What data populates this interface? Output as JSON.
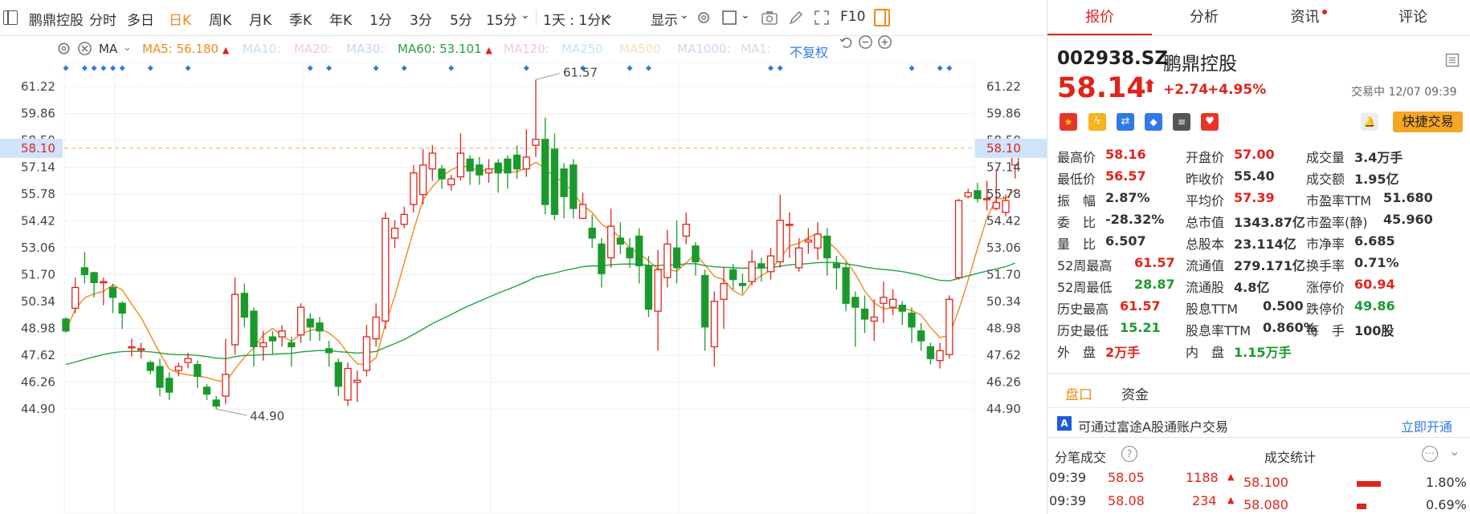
{
  "toolbar": {
    "stock_name": "鹏鼎控股",
    "periods": [
      "分时",
      "多日",
      "日K",
      "周K",
      "月K",
      "季K",
      "年K",
      "1分",
      "3分",
      "5分",
      "15分"
    ],
    "active_period": "日K",
    "range_label": "1天 : 1分K",
    "display_label": "显示",
    "f10_label": "F10"
  },
  "ma_bar": {
    "ma_label": "MA",
    "items": [
      {
        "label": "MA5:",
        "value": "56.180",
        "color": "#f08a1c"
      },
      {
        "label": "MA10:",
        "value": "",
        "color": "#c7dff5"
      },
      {
        "label": "MA20:",
        "value": "",
        "color": "#f5c6d8"
      },
      {
        "label": "MA30:",
        "value": "",
        "color": "#c2d7f0"
      },
      {
        "label": "MA60:",
        "value": "53.101",
        "color": "#27a040"
      },
      {
        "label": "MA120:",
        "value": "",
        "color": "#f5c6d0"
      },
      {
        "label": "MA250",
        "value": "",
        "color": "#bfe6f5"
      },
      {
        "label": "MA500",
        "value": "",
        "color": "#f5e2b5"
      },
      {
        "label": "MA1000:",
        "value": "",
        "color": "#d8d0f0"
      },
      {
        "label": "MA1:",
        "value": "",
        "color": "#d5dbe5"
      }
    ],
    "restore_label": "不复权"
  },
  "chart_data": {
    "type": "candlestick",
    "y_ticks": [
      "61.22",
      "59.86",
      "58.50",
      "57.14",
      "55.78",
      "54.42",
      "53.06",
      "51.70",
      "50.34",
      "48.98",
      "47.62",
      "46.26",
      "44.90"
    ],
    "ylim": [
      44.3,
      62.0
    ],
    "current_price_label": "58.10",
    "high_annotation": "61.57",
    "low_annotation": "44.90",
    "candles": [
      [
        49.45,
        48.85,
        49.55,
        48.75
      ],
      [
        50.0,
        51.05,
        51.55,
        49.75
      ],
      [
        52.05,
        51.7,
        52.85,
        51.25
      ],
      [
        51.8,
        51.3,
        51.85,
        50.55
      ],
      [
        51.3,
        51.35,
        51.55,
        50.15
      ],
      [
        51.05,
        50.55,
        51.25,
        49.75
      ],
      [
        50.25,
        49.75,
        50.35,
        48.95
      ],
      [
        48.05,
        48.05,
        48.45,
        47.55
      ],
      [
        47.95,
        47.95,
        48.25,
        47.45
      ],
      [
        47.25,
        46.85,
        47.35,
        46.65
      ],
      [
        47.05,
        46.0,
        47.45,
        45.55
      ],
      [
        46.45,
        45.75,
        46.75,
        45.35
      ],
      [
        46.85,
        47.05,
        47.25,
        46.55
      ],
      [
        47.25,
        47.45,
        47.75,
        46.95
      ],
      [
        47.15,
        46.55,
        47.35,
        45.95
      ],
      [
        46.0,
        45.65,
        46.15,
        45.35
      ],
      [
        45.35,
        45.05,
        45.55,
        44.9
      ],
      [
        45.55,
        46.65,
        48.45,
        45.15
      ],
      [
        48.15,
        50.7,
        51.55,
        47.65
      ],
      [
        50.75,
        49.55,
        51.25,
        49.05
      ],
      [
        49.85,
        48.05,
        50.05,
        47.05
      ],
      [
        48.05,
        48.25,
        48.85,
        47.35
      ],
      [
        48.55,
        48.35,
        48.85,
        47.65
      ],
      [
        48.55,
        48.85,
        49.15,
        48.05
      ],
      [
        48.25,
        48.05,
        48.55,
        47.05
      ],
      [
        48.65,
        50.05,
        50.25,
        48.25
      ],
      [
        49.45,
        49.05,
        49.75,
        48.35
      ],
      [
        49.25,
        48.85,
        49.55,
        48.35
      ],
      [
        47.95,
        47.75,
        48.35,
        47.05
      ],
      [
        47.25,
        46.05,
        47.45,
        45.55
      ],
      [
        45.35,
        46.95,
        47.25,
        45.05
      ],
      [
        46.25,
        46.35,
        46.85,
        45.25
      ],
      [
        46.85,
        48.55,
        49.15,
        46.55
      ],
      [
        48.45,
        49.55,
        50.25,
        48.05
      ],
      [
        49.35,
        54.55,
        54.85,
        48.95
      ],
      [
        53.55,
        54.05,
        54.45,
        53.05
      ],
      [
        54.25,
        54.75,
        55.15,
        54.05
      ],
      [
        55.25,
        56.85,
        57.25,
        54.85
      ],
      [
        55.75,
        57.25,
        58.05,
        55.25
      ],
      [
        57.05,
        57.85,
        58.25,
        56.45
      ],
      [
        57.05,
        56.55,
        57.25,
        56.05
      ],
      [
        56.25,
        56.55,
        56.75,
        55.95
      ],
      [
        56.65,
        57.85,
        58.85,
        56.45
      ],
      [
        57.55,
        56.95,
        57.75,
        56.25
      ],
      [
        57.25,
        56.75,
        57.65,
        56.25
      ],
      [
        56.85,
        57.05,
        57.55,
        56.35
      ],
      [
        57.35,
        56.85,
        57.55,
        55.85
      ],
      [
        57.55,
        56.85,
        57.75,
        56.05
      ],
      [
        57.75,
        57.05,
        58.25,
        56.55
      ],
      [
        57.05,
        57.65,
        59.05,
        56.65
      ],
      [
        58.25,
        58.55,
        61.57,
        57.65
      ],
      [
        58.55,
        55.25,
        59.65,
        54.75
      ],
      [
        58.05,
        54.75,
        58.85,
        54.45
      ],
      [
        57.05,
        55.65,
        57.35,
        54.55
      ],
      [
        57.25,
        55.05,
        57.55,
        54.55
      ],
      [
        54.55,
        55.25,
        55.85,
        54.55
      ],
      [
        54.05,
        53.55,
        54.75,
        53.05
      ],
      [
        53.25,
        51.75,
        53.55,
        51.05
      ],
      [
        52.55,
        54.15,
        55.05,
        52.05
      ],
      [
        53.55,
        53.25,
        54.35,
        52.75
      ],
      [
        53.05,
        52.55,
        53.55,
        52.05
      ],
      [
        53.65,
        52.15,
        54.05,
        51.25
      ],
      [
        52.15,
        49.95,
        52.65,
        49.55
      ],
      [
        49.85,
        51.95,
        52.95,
        47.85
      ],
      [
        51.55,
        53.25,
        53.95,
        51.05
      ],
      [
        53.05,
        52.05,
        54.45,
        51.25
      ],
      [
        53.65,
        54.25,
        54.85,
        53.25
      ],
      [
        53.15,
        52.35,
        53.35,
        51.65
      ],
      [
        51.65,
        49.05,
        51.95,
        47.85
      ],
      [
        48.05,
        50.35,
        50.85,
        47.05
      ],
      [
        50.45,
        51.25,
        52.05,
        48.95
      ],
      [
        51.95,
        51.45,
        52.25,
        50.95
      ],
      [
        51.25,
        51.15,
        51.75,
        50.75
      ],
      [
        51.35,
        52.35,
        52.95,
        51.15
      ],
      [
        52.25,
        52.05,
        52.55,
        51.35
      ],
      [
        51.85,
        52.65,
        53.05,
        51.45
      ],
      [
        52.35,
        54.45,
        55.75,
        52.05
      ],
      [
        54.25,
        54.25,
        54.85,
        52.55
      ],
      [
        52.05,
        53.05,
        53.55,
        51.85
      ],
      [
        53.35,
        53.45,
        54.05,
        52.75
      ],
      [
        53.05,
        53.75,
        54.35,
        52.45
      ],
      [
        53.65,
        52.55,
        54.05,
        51.65
      ],
      [
        52.25,
        52.05,
        52.65,
        50.95
      ],
      [
        52.05,
        50.25,
        52.35,
        49.85
      ],
      [
        50.55,
        50.05,
        50.85,
        48.05
      ],
      [
        49.95,
        49.45,
        50.65,
        48.75
      ],
      [
        49.35,
        49.55,
        50.45,
        48.35
      ],
      [
        50.25,
        50.55,
        51.35,
        49.25
      ],
      [
        50.05,
        50.45,
        50.95,
        49.65
      ],
      [
        50.15,
        49.85,
        50.35,
        49.15
      ],
      [
        49.75,
        49.05,
        50.05,
        48.25
      ],
      [
        48.85,
        48.35,
        49.25,
        47.85
      ],
      [
        48.05,
        47.45,
        48.25,
        47.15
      ],
      [
        47.35,
        47.85,
        48.25,
        46.95
      ],
      [
        47.65,
        50.45,
        50.65,
        47.45
      ],
      [
        51.55,
        55.45,
        55.55,
        51.45
      ],
      [
        55.65,
        55.85,
        56.05,
        55.55
      ],
      [
        55.95,
        55.55,
        56.35,
        55.35
      ],
      [
        55.55,
        55.55,
        56.45,
        54.95
      ],
      [
        55.05,
        55.35,
        57.05,
        54.95
      ],
      [
        54.85,
        55.45,
        55.75,
        54.65
      ],
      [
        57.25,
        58.14,
        58.16,
        56.57
      ]
    ]
  },
  "tabs": [
    "报价",
    "分析",
    "资讯",
    "评论"
  ],
  "active_tab": "报价",
  "quote": {
    "code": "002938.SZ",
    "name": "鹏鼎控股",
    "price": "58.14",
    "change": "+2.74",
    "change_pct": "+4.95%",
    "status": "交易中 12/07 09:39",
    "quick_trade_label": "快捷交易",
    "fields": [
      [
        {
          "label": "最高价",
          "value": "58.16",
          "color": "red"
        },
        {
          "label": "开盘价",
          "value": "57.00",
          "color": "red"
        },
        {
          "label": "成交量",
          "value": "3.4万手",
          "color": "dark"
        }
      ],
      [
        {
          "label": "最低价",
          "value": "56.57",
          "color": "red"
        },
        {
          "label": "昨收价",
          "value": "55.40",
          "color": "dark"
        },
        {
          "label": "成交额",
          "value": "1.95亿",
          "color": "dark"
        }
      ],
      [
        {
          "label": "振　幅",
          "value": "2.87%",
          "color": "dark"
        },
        {
          "label": "平均价",
          "value": "57.39",
          "color": "red"
        },
        {
          "label": "市盈率TTM",
          "value": "51.680",
          "color": "dark"
        }
      ],
      [
        {
          "label": "委　比",
          "value": "-28.32%",
          "color": "dark"
        },
        {
          "label": "总市值",
          "value": "1343.87亿",
          "color": "dark"
        },
        {
          "label": "市盈率(静)",
          "value": "45.960",
          "color": "dark"
        }
      ],
      [
        {
          "label": "量　比",
          "value": "6.507",
          "color": "dark"
        },
        {
          "label": "总股本",
          "value": "23.114亿",
          "color": "dark"
        },
        {
          "label": "市净率",
          "value": "6.685",
          "color": "dark"
        }
      ],
      [
        {
          "label": "52周最高",
          "value": "61.57",
          "color": "red"
        },
        {
          "label": "流通值",
          "value": "279.171亿",
          "color": "dark"
        },
        {
          "label": "换手率",
          "value": "0.71%",
          "color": "dark"
        }
      ],
      [
        {
          "label": "52周最低",
          "value": "28.87",
          "color": "green"
        },
        {
          "label": "流通股",
          "value": "4.8亿",
          "color": "dark"
        },
        {
          "label": "涨停价",
          "value": "60.94",
          "color": "red"
        }
      ],
      [
        {
          "label": "历史最高",
          "value": "61.57",
          "color": "red"
        },
        {
          "label": "股息TTM",
          "value": "0.500",
          "color": "dark"
        },
        {
          "label": "跌停价",
          "value": "49.86",
          "color": "green"
        }
      ],
      [
        {
          "label": "历史最低",
          "value": "15.21",
          "color": "green"
        },
        {
          "label": "股息率TTM",
          "value": "0.860%",
          "color": "dark"
        },
        {
          "label": "每　手",
          "value": "100股",
          "color": "dark"
        }
      ],
      [
        {
          "label": "外　盘",
          "value": "2万手",
          "color": "red"
        },
        {
          "label": "内　盘",
          "value": "1.15万手",
          "color": "green"
        },
        {
          "label": "",
          "value": "",
          "color": "dark"
        }
      ]
    ]
  },
  "subtabs": [
    "盘口",
    "资金"
  ],
  "banner": {
    "text": "可通过富途A股通账户交易",
    "link": "立即开通"
  },
  "ticks_title": "分笔成交",
  "stats_title": "成交统计",
  "trade_ticks": [
    {
      "time": "09:39",
      "price": "58.05",
      "vol": "1188"
    },
    {
      "time": "09:39",
      "price": "58.08",
      "vol": "234"
    }
  ],
  "trade_stats": [
    {
      "price": "58.100",
      "pct": "1.80%"
    },
    {
      "price": "58.080",
      "pct": "0.69%"
    }
  ],
  "colors": {
    "up": "#e0241c",
    "down": "#1a9a2c",
    "accent": "#2f7ae5",
    "ma5": "#f08a1c",
    "ma60": "#27a040",
    "quick": "#f5a623"
  }
}
